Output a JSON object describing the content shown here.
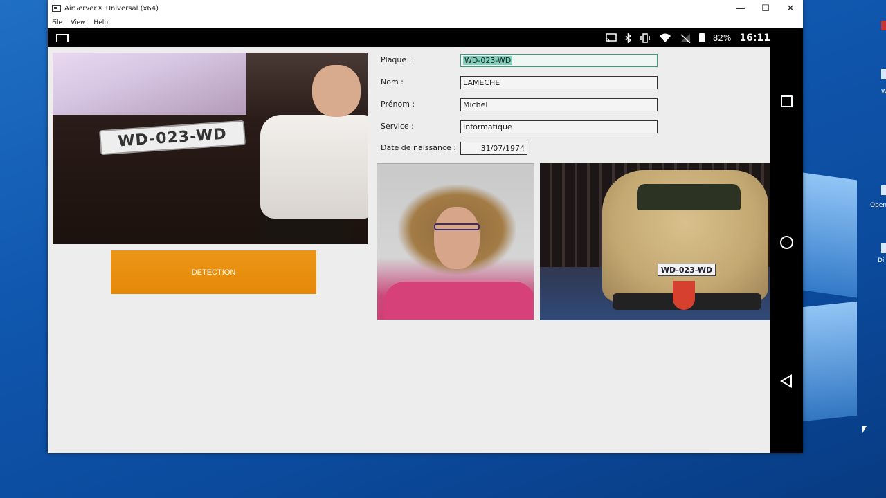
{
  "window": {
    "title": "AirServer® Universal (x64)",
    "controls": {
      "minimize": "—",
      "maximize": "☐",
      "close": "✕"
    },
    "menu": [
      "File",
      "View",
      "Help"
    ]
  },
  "statusbar": {
    "icons": [
      "cast-icon",
      "bluetooth-icon",
      "vibrate-icon",
      "wifi-icon",
      "no-signal-icon",
      "battery-icon"
    ],
    "battery": "82%",
    "time": "16:11"
  },
  "detection": {
    "button_label": "DETECTION"
  },
  "photo_main": {
    "plate_text": "WD-023-WD"
  },
  "form": {
    "plaque": {
      "label": "Plaque :",
      "value": "WD-023-WD"
    },
    "nom": {
      "label": "Nom :",
      "value": "LAMECHE"
    },
    "prenom": {
      "label": "Prénom :",
      "value": "Michel"
    },
    "service": {
      "label": "Service :",
      "value": "Informatique"
    },
    "naissance": {
      "label": "Date de naissance :",
      "value": "31/07/1974"
    }
  },
  "photo_car": {
    "plate_text": "WD-023-WD"
  },
  "desktop": {
    "icon_labels": [
      "W",
      "Open",
      "Di"
    ]
  }
}
